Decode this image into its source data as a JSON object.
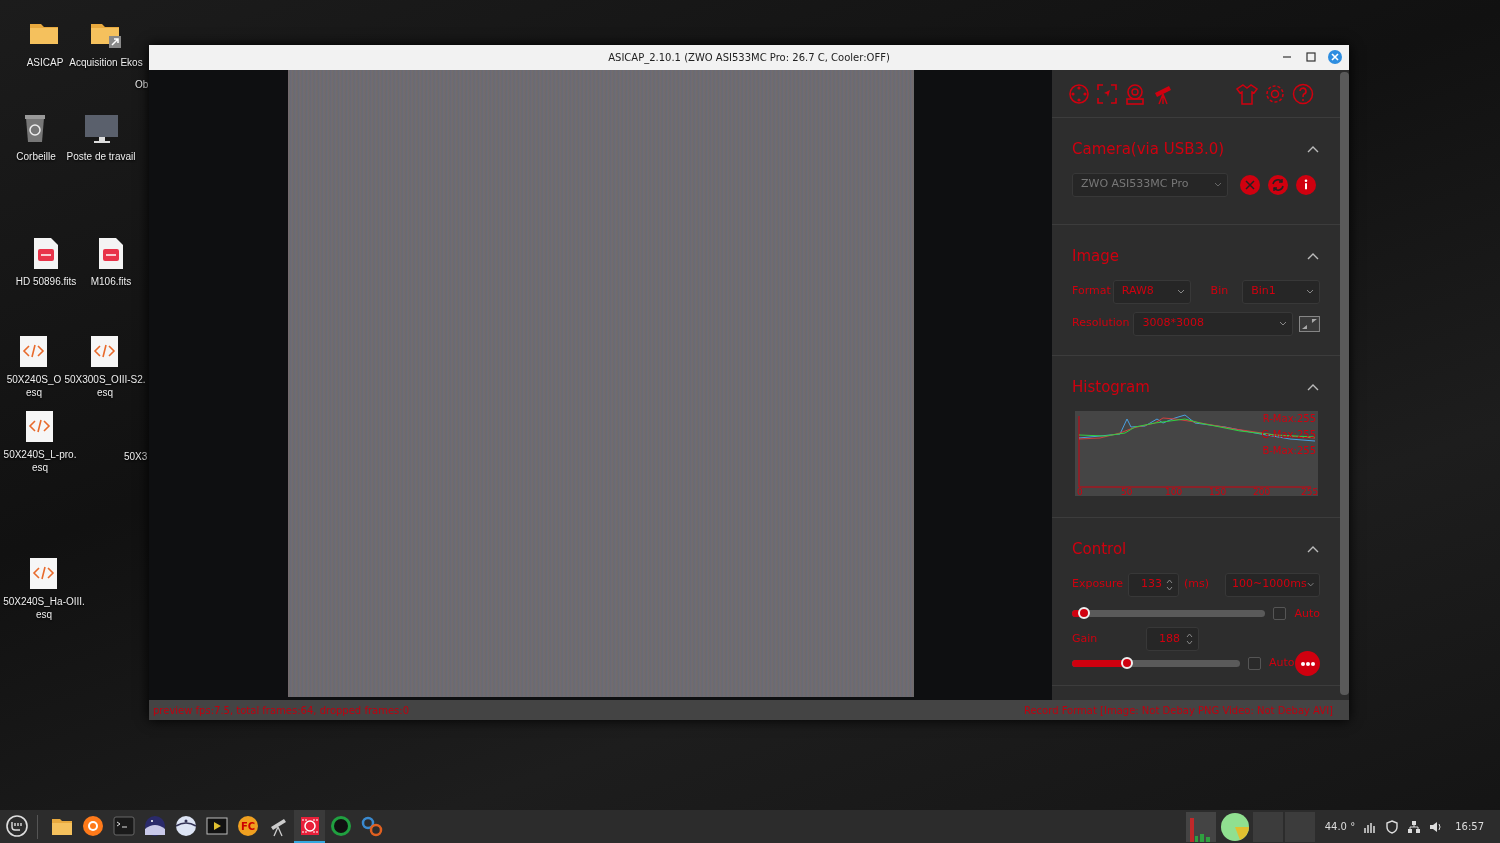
{
  "desktop_icons": [
    {
      "kind": "folder",
      "lines": [
        "ASICAP"
      ]
    },
    {
      "kind": "folder-link",
      "lines": [
        "Acquisition Ekos"
      ]
    },
    {
      "kind": "label-only",
      "lines": [
        "Ob"
      ]
    },
    {
      "kind": "trash",
      "lines": [
        "Corbeille"
      ]
    },
    {
      "kind": "monitor",
      "lines": [
        "Poste de travail"
      ]
    },
    {
      "kind": "fits",
      "lines": [
        "HD 50896.fits"
      ]
    },
    {
      "kind": "fits",
      "lines": [
        "M106.fits"
      ]
    },
    {
      "kind": "code",
      "lines": [
        "50X240S_O",
        "esq"
      ]
    },
    {
      "kind": "code",
      "lines": [
        "50X300S_OIII-S2.",
        "esq"
      ]
    },
    {
      "kind": "code",
      "lines": [
        "50X240S_L-pro.",
        "esq"
      ]
    },
    {
      "kind": "label-only",
      "lines": [
        "50X3"
      ]
    },
    {
      "kind": "code",
      "lines": [
        "50X240S_Ha-OIII.",
        "esq"
      ]
    }
  ],
  "window": {
    "title": "ASICAP_2.10.1 (ZWO ASI533MC Pro: 26.7 C, Cooler:OFF)",
    "panel": {
      "camera": {
        "title": "Camera(via USB3.0)",
        "expanded": true,
        "device": "ZWO ASI533MC Pro"
      },
      "image": {
        "title": "Image",
        "expanded": true,
        "format_label": "Format",
        "format": "RAW8",
        "bin_label": "Bin",
        "bin": "Bin1",
        "resolution_label": "Resolution",
        "resolution": "3008*3008"
      },
      "histogram": {
        "title": "Histogram",
        "expanded": true,
        "max_labels": [
          "R-Max:255",
          "G-Max:255",
          "B-Max:255"
        ],
        "x_labels": [
          "0",
          "50",
          "100",
          "150",
          "200",
          "255"
        ]
      },
      "control": {
        "title": "Control",
        "expanded": true,
        "exposure": {
          "label": "Exposure",
          "value": "133",
          "unit": "(ms)",
          "range": "100~1000ms",
          "level": 0.06,
          "auto_label": "Auto",
          "auto": false
        },
        "gain": {
          "label": "Gain",
          "value": "188",
          "level": 0.33,
          "auto_label": "Auto",
          "auto": false
        }
      }
    },
    "status_left": "preview fps:7.5, total frames:64, dropped frames:0",
    "status_right": "Record Format [Image: Not Debay PNG Video: Not Debay AVI]"
  },
  "taskbar": {
    "apps": [
      {
        "kind": "folder",
        "selected": false
      },
      {
        "kind": "browser",
        "selected": false
      },
      {
        "kind": "terminal",
        "selected": false
      },
      {
        "kind": "planetarium",
        "selected": false
      },
      {
        "kind": "globe",
        "selected": false
      },
      {
        "kind": "video",
        "selected": false
      },
      {
        "kind": "fc",
        "label": "FC",
        "selected": false
      },
      {
        "kind": "telescope",
        "selected": false
      },
      {
        "kind": "capture",
        "selected": true
      },
      {
        "kind": "guider",
        "selected": false
      },
      {
        "kind": "gears",
        "selected": false
      }
    ],
    "temperature": "44.0 °",
    "clock": "16:57"
  }
}
